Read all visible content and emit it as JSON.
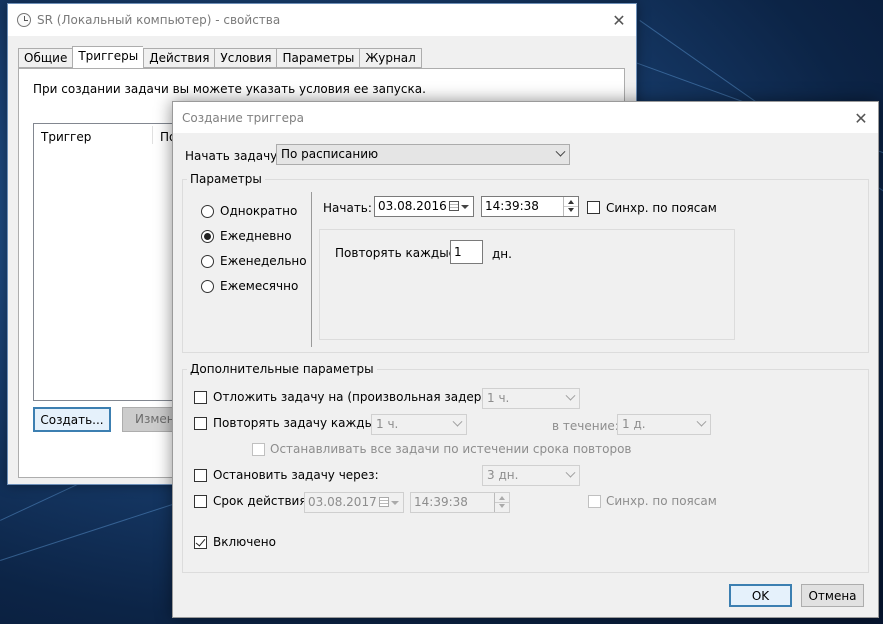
{
  "back_window": {
    "title": "SR (Локальный компьютер) - свойства",
    "tabs": [
      "Общие",
      "Триггеры",
      "Действия",
      "Условия",
      "Параметры",
      "Журнал"
    ],
    "active_tab": "Триггеры",
    "description": "При создании задачи вы можете указать условия ее запуска.",
    "list_headers": [
      "Триггер",
      "По"
    ],
    "create_button": "Создать...",
    "change_button": "Изменить..."
  },
  "dialog": {
    "title": "Создание триггера",
    "start_task_label": "Начать задачу:",
    "start_task_value": "По расписанию",
    "params_group": "Параметры",
    "schedule_options": [
      "Однократно",
      "Ежедневно",
      "Еженедельно",
      "Ежемесячно"
    ],
    "schedule_selected": "Ежедневно",
    "start_label": "Начать:",
    "start_date": "03.08.2016",
    "start_time": "14:39:38",
    "sync_tz_label": "Синхр. по поясам",
    "sync_tz_checked": false,
    "repeat_every_label": "Повторять каждые:",
    "repeat_every_value": "1",
    "repeat_unit": "дн.",
    "advanced_group": "Дополнительные параметры",
    "delay": {
      "label": "Отложить задачу на (произвольная задержка):",
      "checked": false,
      "value": "1 ч."
    },
    "repeat_task": {
      "label": "Повторять задачу каждые:",
      "checked": false,
      "value": "1 ч.",
      "duration_label": "в течение:",
      "duration_value": "1 д."
    },
    "stop_all_label": "Останавливать все задачи по истечении срока повторов",
    "stop_after": {
      "label": "Остановить задачу через:",
      "checked": false,
      "value": "3 дн."
    },
    "expire": {
      "label": "Срок действия:",
      "checked": false,
      "date": "03.08.2017",
      "time": "14:39:38",
      "sync_label": "Синхр. по поясам"
    },
    "enabled": {
      "label": "Включено",
      "checked": true
    },
    "ok_button": "OK",
    "cancel_button": "Отмена"
  }
}
